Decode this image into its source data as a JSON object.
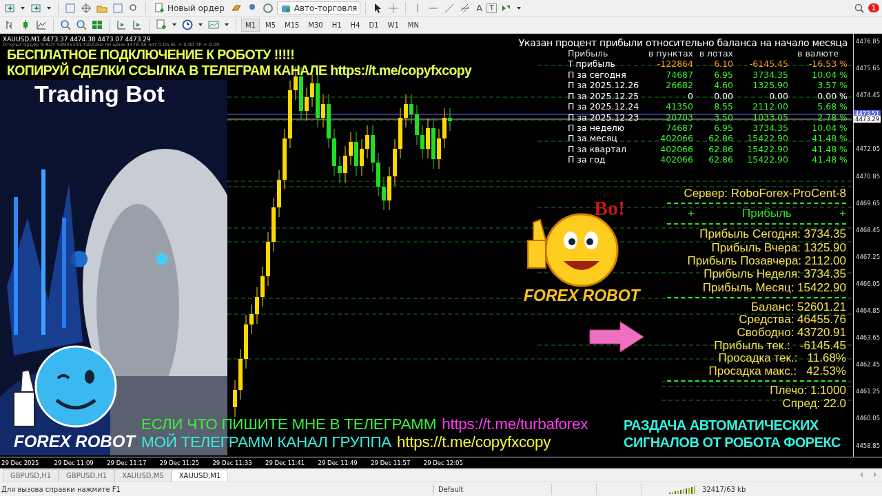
{
  "toolbar": {
    "new_order": "Новый ордер",
    "autotrading": "Авто-торговля",
    "text_tools": [
      "A",
      "T"
    ],
    "notifications": "1"
  },
  "timeframes": [
    {
      "label": "M1",
      "selected": true
    },
    {
      "label": "M5",
      "selected": false
    },
    {
      "label": "M15",
      "selected": false
    },
    {
      "label": "M30",
      "selected": false
    },
    {
      "label": "H1",
      "selected": false
    },
    {
      "label": "H4",
      "selected": false
    },
    {
      "label": "D1",
      "selected": false
    },
    {
      "label": "W1",
      "selected": false
    },
    {
      "label": "MN",
      "selected": false
    }
  ],
  "chart": {
    "header": "XAUUSD,M1  4473.37 4474.38 4473.07 4473.29",
    "order_note": "Открыт ордер N BUY 58935334 XAUUSD по цене 4476.38 лот 0.05 SL = 0.00 TP = 0.00",
    "banner": [
      "БЕСПЛАТНОЕ ПОДКЛЮЧЕНИЕ К РОБОТУ !!!!!",
      "КОПИРУЙ СДЕЛКИ ССЫЛКА В ТЕЛЕГРАМ КАНАЛЕ https://t.me/copyfxcopy"
    ],
    "promo_title": "Trading Bot",
    "robot_caption": "FOREX ROBOT",
    "smiley_caption": "FOREX ROBOT",
    "smiley_shout": "Bo!",
    "contact_lines": [
      {
        "text": "ЕСЛИ ЧТО ПИШИТЕ МНЕ В ТЕЛЕГРАММ",
        "link": "https://t.me/turbaforex",
        "kind": "personal"
      },
      {
        "text": "МОЙ ТЕЛЕГРАММ КАНАЛ ГРУППА",
        "link": "https://t.me/copyfxcopy",
        "kind": "channel"
      }
    ],
    "signals_text": [
      "РАЗДАЧА АВТОМАТИЧЕСКИХ",
      "СИГНАЛОВ ОТ РОБОТА ФОРЕКС"
    ]
  },
  "stats": {
    "title": "Указан процент прибыли относительно баланса на начало месяца",
    "columns": [
      "Прибыль",
      "в пунктах",
      "в лотах",
      "в валюте"
    ],
    "rows": [
      {
        "label": "Т прибыль",
        "points": "-122864",
        "lots": "6.10",
        "money": "-6145.45",
        "percent": "-16.53 %",
        "kind": "open"
      },
      {
        "label": "П за сегодня",
        "points": "74687",
        "lots": "6.95",
        "money": "3734.35",
        "percent": "10.04 %",
        "kind": "profit"
      },
      {
        "label": "П за 2025.12.26",
        "points": "26682",
        "lots": "4.60",
        "money": "1325.90",
        "percent": "3.57 %",
        "kind": "profit"
      },
      {
        "label": "П за 2025.12.25",
        "points": "0",
        "lots": "0.00",
        "money": "0.00",
        "percent": "0.00 %",
        "kind": "flat"
      },
      {
        "label": "П за 2025.12.24",
        "points": "41350",
        "lots": "8.55",
        "money": "2112.00",
        "percent": "5.68 %",
        "kind": "profit"
      },
      {
        "label": "П за 2025.12.23",
        "points": "20703",
        "lots": "3.50",
        "money": "1033.05",
        "percent": "2.78 %",
        "kind": "profit"
      },
      {
        "label": "П за неделю",
        "points": "74687",
        "lots": "6.95",
        "money": "3734.35",
        "percent": "10.04 %",
        "kind": "profit"
      },
      {
        "label": "П за месяц",
        "points": "402066",
        "lots": "62.86",
        "money": "15422.90",
        "percent": "41.48 %",
        "kind": "profit"
      },
      {
        "label": "П за квартал",
        "points": "402066",
        "lots": "62.86",
        "money": "15422.90",
        "percent": "41.48 %",
        "kind": "profit"
      },
      {
        "label": "П за год",
        "points": "402066",
        "lots": "62.86",
        "money": "15422.90",
        "percent": "41.48 %",
        "kind": "profit"
      }
    ]
  },
  "account": {
    "server": "Сервер: RoboForex-ProCent-8",
    "section_marks": [
      "+",
      "+"
    ],
    "section": "Прибыль",
    "profits": [
      "Прибыль Сегодня: 3734.35",
      "Прибыль Вчера: 1325.90",
      "Прибыль Позавчера: 2112.00",
      "Прибыль Неделя: 3734.35",
      "Прибыль Месяц: 15422.90"
    ],
    "balances": [
      "Баланс: 52601.21",
      "Средства: 46455.76",
      "Свободно: 43720.91",
      "Прибыль тек.:   -6145.45",
      "Просадка тек.:   11.68%",
      "Просадка макс.:   42.53%"
    ],
    "extra": [
      "Плечо: 1:1000",
      "Спред: 22.0"
    ]
  },
  "price_axis": {
    "labels": [
      "4476.85",
      "4475.65",
      "4474.45",
      "4472.05",
      "4470.85",
      "4469.65",
      "4468.45",
      "4467.25",
      "4466.05",
      "4464.85",
      "4463.65",
      "4462.45",
      "4461.25",
      "4460.05",
      "4458.85"
    ],
    "markers": [
      {
        "text": "4473.51",
        "kind": "ask"
      },
      {
        "text": "4473.29",
        "kind": "bid"
      }
    ]
  },
  "time_axis": [
    "29 Dec 2025",
    "29 Dec 11:09",
    "29 Dec 11:17",
    "29 Dec 11:25",
    "29 Dec 11:33",
    "29 Dec 11:41",
    "29 Dec 11:49",
    "29 Dec 11:57",
    "29 Dec 12:05"
  ],
  "chart_tabs": [
    {
      "label": "GBPUSD,H1",
      "selected": false
    },
    {
      "label": "GBPUSD,H1",
      "selected": false
    },
    {
      "label": "XAUUSD,M5",
      "selected": false
    },
    {
      "label": "XAUUSD,M1",
      "selected": true
    }
  ],
  "status_bar": {
    "help": "Для вызова справки нажмите F1",
    "profile": "Default",
    "traffic": "32417/63 kb"
  }
}
